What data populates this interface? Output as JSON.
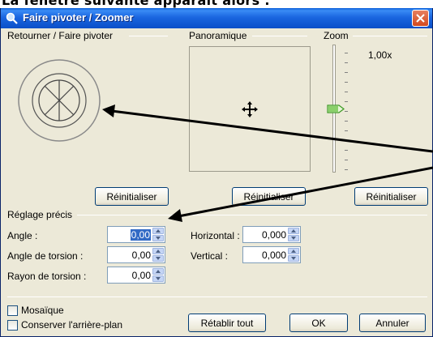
{
  "caption": "La fenêtre suivante apparaît alors :",
  "window": {
    "title": "Faire pivoter / Zoomer"
  },
  "sections": {
    "rotate": "Retourner / Faire pivoter",
    "pan": "Panoramique",
    "zoom": "Zoom",
    "fine": "Réglage précis"
  },
  "zoom": {
    "value_text": "1,00x",
    "level": 0.5
  },
  "reset_label": "Réinitialiser",
  "fields": {
    "angle": {
      "label": "Angle :",
      "value": "0,00"
    },
    "torsion_angle": {
      "label": "Angle de torsion :",
      "value": "0,00"
    },
    "torsion_radius": {
      "label": "Rayon de torsion :",
      "value": "0,00"
    },
    "horizontal": {
      "label": "Horizontal :",
      "value": "0,000"
    },
    "vertical": {
      "label": "Vertical :",
      "value": "0,000"
    }
  },
  "options": {
    "tile": "Mosaïque",
    "keep_background": "Conserver l'arrière-plan"
  },
  "buttons": {
    "reset_all": "Rétablir tout",
    "ok": "OK",
    "cancel": "Annuler"
  },
  "colors": {
    "titlebar": "#0a5fd8",
    "dialog_bg": "#ece9d8",
    "selection": "#316ac5",
    "close": "#d34a1f"
  }
}
